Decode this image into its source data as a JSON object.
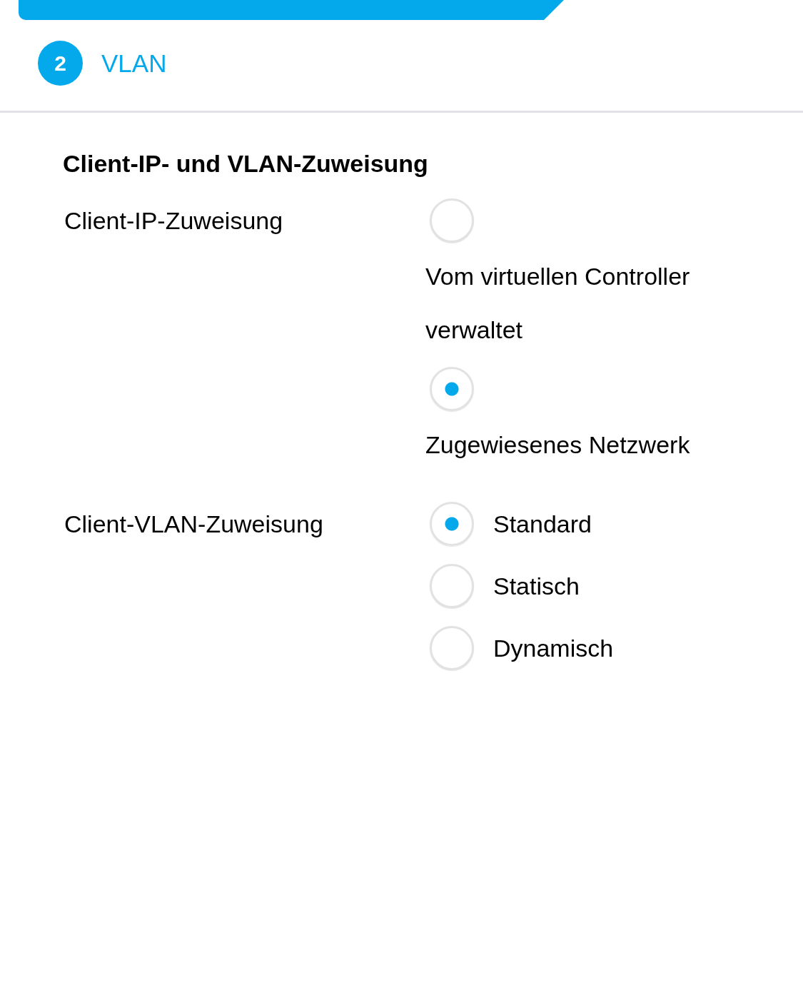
{
  "step": {
    "number": "2",
    "title": "VLAN"
  },
  "section": {
    "title": "Client-IP- und VLAN-Zuweisung",
    "fields": [
      {
        "label": "Client-IP-Zuweisung",
        "kind": "stacked",
        "options": [
          {
            "label": "Vom virtuellen Controller verwaltet",
            "selected": false
          },
          {
            "label": "Zugewiesenes Netzwerk",
            "selected": true
          }
        ]
      },
      {
        "label": "Client-VLAN-Zuweisung",
        "kind": "inline",
        "options": [
          {
            "label": "Standard",
            "selected": true
          },
          {
            "label": "Statisch",
            "selected": false
          },
          {
            "label": "Dynamisch",
            "selected": false
          }
        ]
      }
    ]
  }
}
